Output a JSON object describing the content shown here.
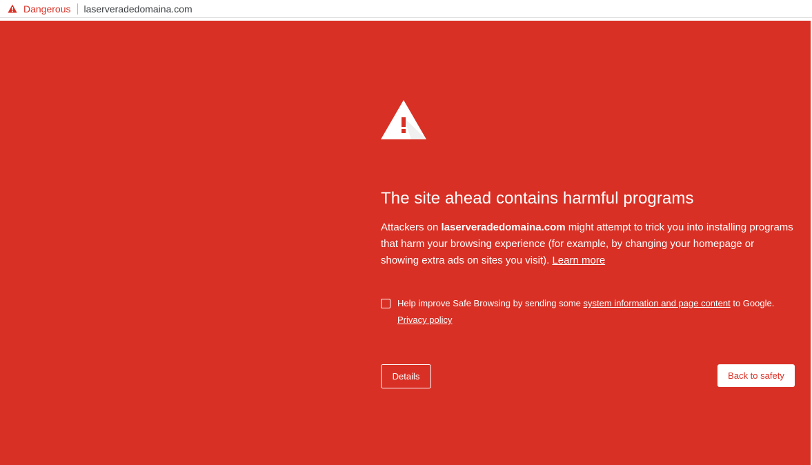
{
  "omnibox": {
    "security_icon": "warning-triangle-icon",
    "security_label": "Dangerous",
    "url": "laserveradedomaina.com"
  },
  "interstitial": {
    "background_color": "#d93025",
    "icon": "warning-triangle-icon",
    "heading": "The site ahead contains harmful programs",
    "paragraph": {
      "prefix": "Attackers on ",
      "domain": "laserveradedomaina.com",
      "suffix": " might attempt to trick you into installing programs that harm your browsing experience (for example, by changing your homepage or showing extra ads on sites you visit). ",
      "learn_more": "Learn more"
    },
    "optin": {
      "checked": false,
      "prefix": "Help improve Safe Browsing by sending some ",
      "link": "system information and page content",
      "suffix": " to Google.",
      "privacy_link": "Privacy policy"
    },
    "buttons": {
      "details": "Details",
      "back_to_safety": "Back to safety"
    }
  }
}
